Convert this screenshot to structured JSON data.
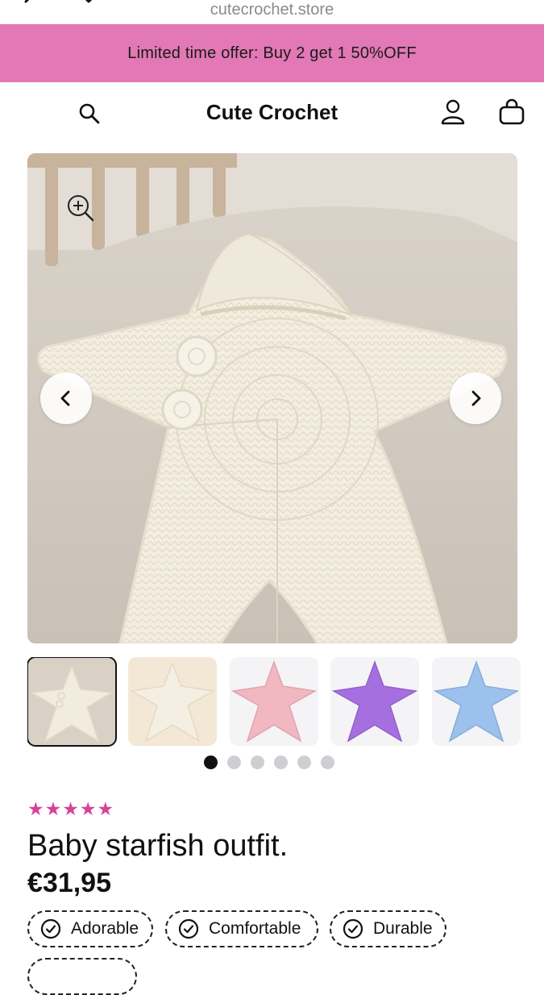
{
  "browser": {
    "url": "cutecrochet.store"
  },
  "promo": {
    "text": "Limited time offer: Buy 2 get 1 50%OFF",
    "color": "#e278b5"
  },
  "header": {
    "store_title": "Cute Crochet"
  },
  "gallery": {
    "active_index": 0,
    "thumbnail_colors": [
      "#f2ecdf",
      "#f3e8d6",
      "#f1b8c1",
      "#a66fe0",
      "#9bc1ec"
    ],
    "dot_count": 6
  },
  "product": {
    "rating": "★★★★★",
    "title": "Baby starfish outfit.",
    "price": "€31,95",
    "badges": [
      "Adorable",
      "Comfortable",
      "Durable"
    ]
  },
  "colors": {
    "star_color": "#d7429a",
    "accent": "#111111"
  }
}
